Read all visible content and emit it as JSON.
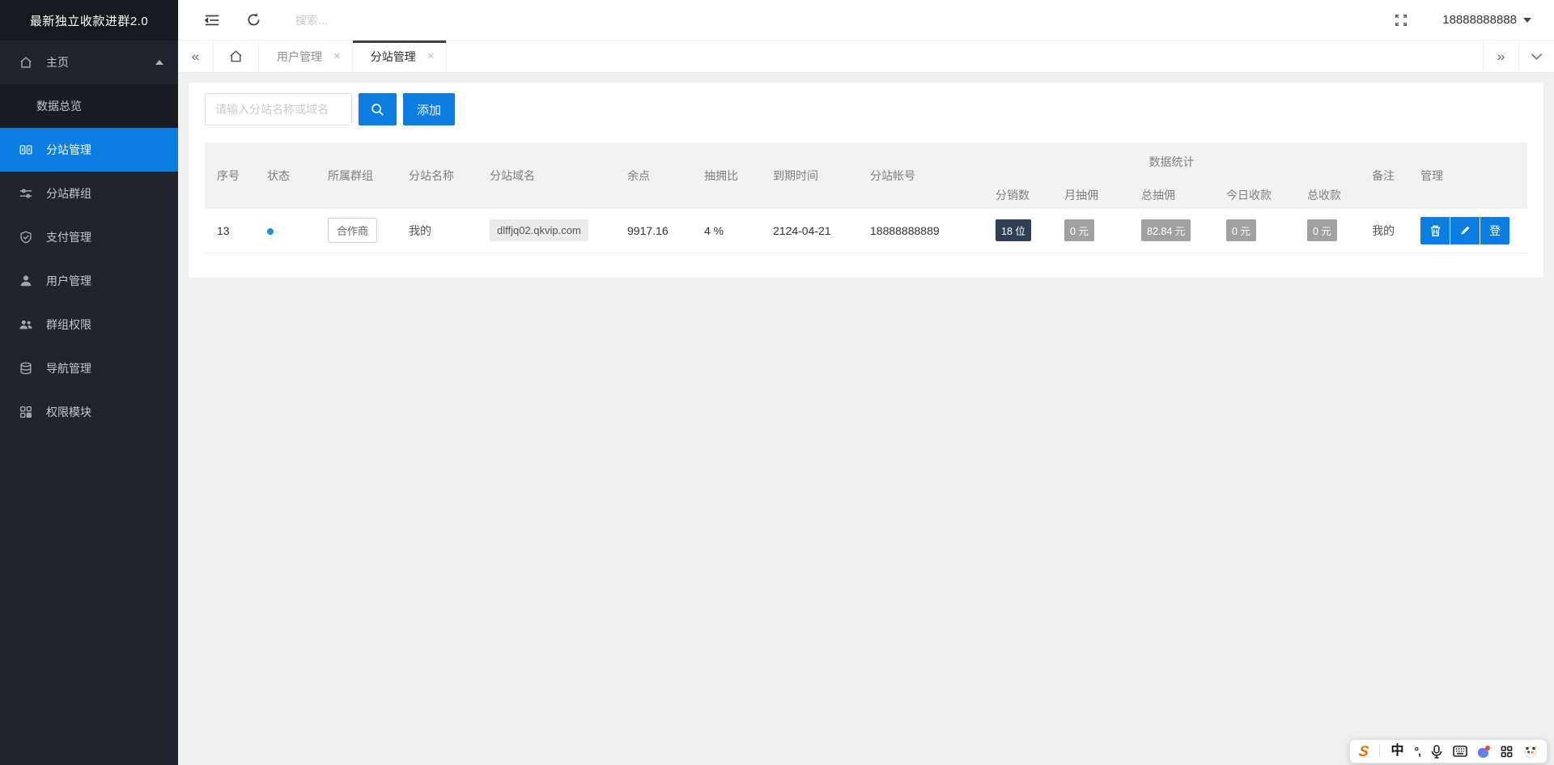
{
  "colors": {
    "primary_blue": "#0b7ce0",
    "sidebar_bg": "#20242c",
    "sidebar_header_bg": "#16191f",
    "active_tab_bar": "#393d49",
    "status_dot_blue": "#1296db",
    "badge_dark": "#2f4056",
    "badge_gray": "#a1a1a1",
    "page_bg": "#f0f0f0"
  },
  "app": {
    "title": "最新独立收款进群2.0"
  },
  "sidebar": {
    "items": [
      {
        "label": "主页",
        "icon": "home-icon"
      },
      {
        "label": "数据总览",
        "icon": "none"
      },
      {
        "label": "分站管理",
        "icon": "columns-icon"
      },
      {
        "label": "分站群组",
        "icon": "sliders-icon"
      },
      {
        "label": "支付管理",
        "icon": "shield-check-icon"
      },
      {
        "label": "用户管理",
        "icon": "user-icon"
      },
      {
        "label": "群组权限",
        "icon": "users-icon"
      },
      {
        "label": "导航管理",
        "icon": "archive-icon"
      },
      {
        "label": "权限模块",
        "icon": "modules-icon"
      }
    ]
  },
  "topbar": {
    "search_placeholder": "搜索...",
    "username": "18888888888"
  },
  "tabs": {
    "items": [
      {
        "label": "用户管理",
        "active": false
      },
      {
        "label": "分站管理",
        "active": true
      }
    ]
  },
  "icons": {
    "close": "×",
    "chevrons_left": "«",
    "chevrons_right": "»"
  },
  "toolbar": {
    "filter_placeholder": "请输入分站名称或域名",
    "add_label": "添加"
  },
  "table": {
    "headers_main": [
      "序号",
      "状态",
      "所属群组",
      "分站名称",
      "分站域名",
      "余点",
      "抽拥比",
      "到期时间",
      "分站帐号"
    ],
    "group_header": "数据统计",
    "headers_stats": [
      "分销数",
      "月抽佣",
      "总抽佣",
      "今日收款",
      "总收款"
    ],
    "headers_tail": [
      "备注",
      "管理"
    ],
    "row": {
      "seq": "13",
      "group_tag": "合作商",
      "site_name": "我的",
      "domain": "dlffjq02.qkvip.com",
      "balance": "9917.16",
      "commission_rate": "4 %",
      "expire_date": "2124-04-21",
      "account": "18888888889",
      "stats": {
        "distributors": "18 位",
        "month_commission": "0 元",
        "total_commission": "82.84 元",
        "today_income": "0 元",
        "total_income": "0 元"
      },
      "remark": "我的",
      "login_label": "登"
    }
  },
  "ime_bar": {
    "logo": "S",
    "lang_mode": "中",
    "punctuation": "°,"
  }
}
